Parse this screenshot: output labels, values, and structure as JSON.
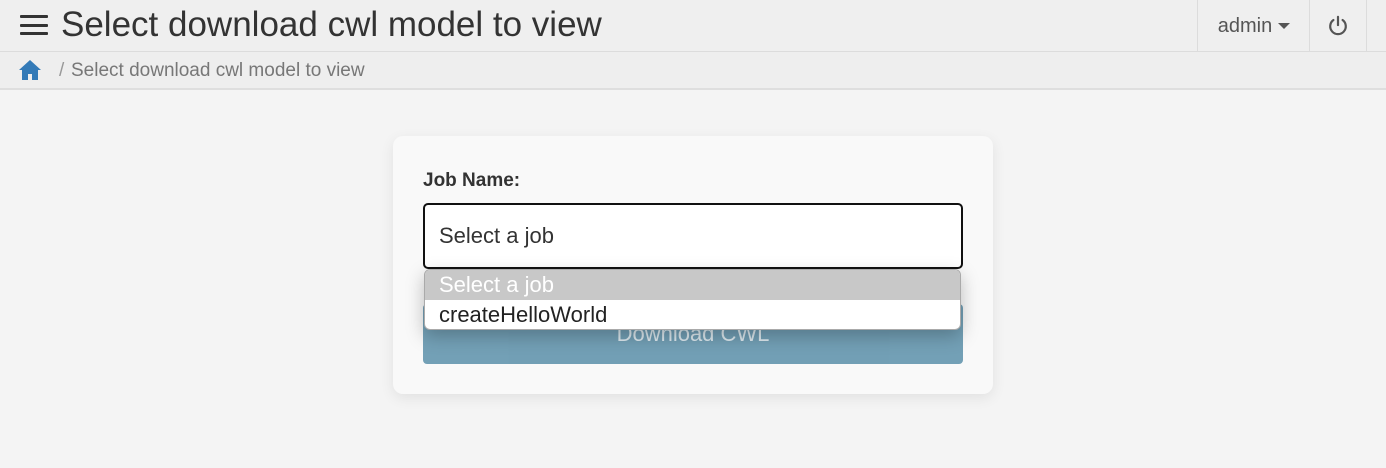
{
  "header": {
    "title": "Select download cwl model to view",
    "menu_icon": "hamburger-icon",
    "user_label": "admin",
    "power_icon": "power-icon"
  },
  "breadcrumb": {
    "home_icon": "home-icon",
    "separator": "/",
    "current": "Select download cwl model to view"
  },
  "form": {
    "job_label": "Job Name:",
    "select_value": "Select a job",
    "options": [
      "Select a job",
      "createHelloWorld"
    ],
    "download_label": "Download CWL"
  },
  "colors": {
    "accent_button": "#6b9bb2",
    "home_icon": "#337ab7",
    "selected_option": "#c8c8c8"
  }
}
